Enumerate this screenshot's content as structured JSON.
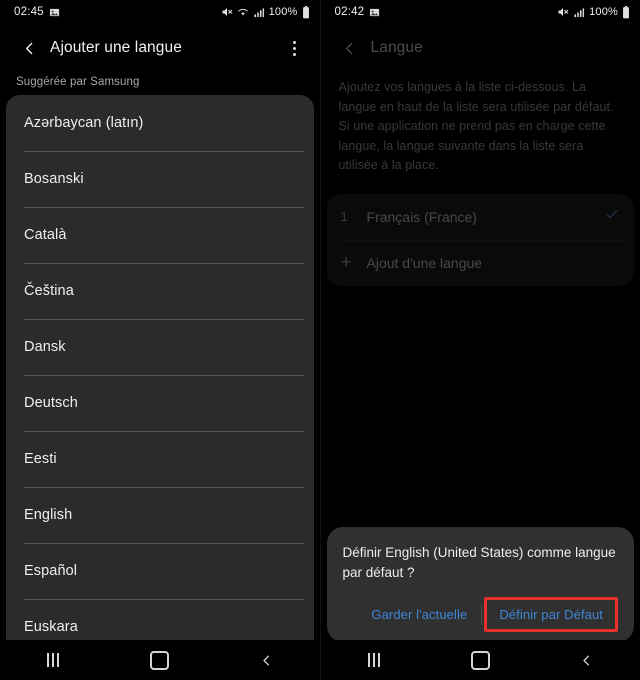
{
  "left": {
    "status": {
      "time": "02:45",
      "icons": [
        "image-icon",
        "mute-icon",
        "wifi-icon",
        "signal-icon"
      ],
      "battery_percent": "100%"
    },
    "appbar": {
      "back_icon": "back-chevron-icon",
      "title": "Ajouter une langue",
      "overflow_icon": "overflow-menu-icon"
    },
    "section_label": "Suggérée par Samsung",
    "languages": [
      "Azərbaycan (latın)",
      "Bosanski",
      "Català",
      "Čeština",
      "Dansk",
      "Deutsch",
      "Eesti",
      "English",
      "Español",
      "Euskara"
    ]
  },
  "right": {
    "status": {
      "time": "02:42",
      "icons": [
        "image-icon",
        "mute-icon",
        "signal-icon"
      ],
      "battery_percent": "100%"
    },
    "appbar": {
      "back_icon": "back-chevron-icon",
      "title": "Langue"
    },
    "description": "Ajoutez vos langues à la liste ci-dessous. La langue en haut de la liste sera utilisée par défaut. Si une application ne prend pas en charge cette langue, la langue suivante dans la liste sera utilisée à la place.",
    "language_rows": [
      {
        "index": "1",
        "label": "Français (France)",
        "checked": true
      },
      {
        "index": "+",
        "label": "Ajout d'une langue",
        "checked": false
      }
    ],
    "dialog": {
      "message": "Définir English (United States) comme langue par défaut ?",
      "cancel_label": "Garder l'actuelle",
      "confirm_label": "Définir par Défaut",
      "highlight_color": "#e8312a",
      "button_text_color": "#3e86d8"
    }
  },
  "navbar": {
    "recents_icon": "recents-icon",
    "home_icon": "home-icon",
    "back_icon": "back-icon"
  }
}
